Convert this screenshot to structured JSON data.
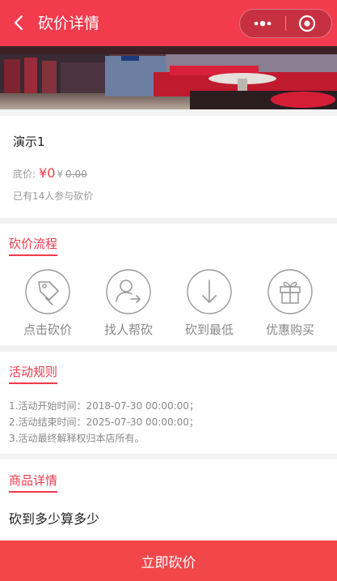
{
  "navbar": {
    "title": "砍价详情",
    "back_icon": "chevron-left-icon",
    "more_icon": "more-dots-icon",
    "close_icon": "target-circle-icon",
    "background": "#f23b4d"
  },
  "banner": {
    "icon": "ktv-room-image"
  },
  "product": {
    "name": "演示1",
    "price_label": "底价:",
    "current_price": "¥0",
    "original_currency": "¥",
    "original_price": "0.00",
    "participants": "已有14人参与砍价",
    "price_color": "#f23b4d"
  },
  "flow": {
    "title": "砍价流程",
    "steps": [
      {
        "label": "点击砍价",
        "icon": "tag-icon"
      },
      {
        "label": "找人帮砍",
        "icon": "user-share-icon"
      },
      {
        "label": "砍到最低",
        "icon": "arrow-down-icon"
      },
      {
        "label": "优惠购买",
        "icon": "gift-icon"
      }
    ]
  },
  "rules": {
    "title": "活动规则",
    "items": [
      "1.活动开始时间：2018-07-30 00:00:00；",
      "2.活动结束时间：2025-07-30 00:00:00；",
      "3.活动最终解释权归本店所有。"
    ]
  },
  "detail": {
    "title": "商品详情",
    "text": "砍到多少算多少"
  },
  "bottom": {
    "button_label": "立即砍价",
    "color": "#f2474a"
  }
}
